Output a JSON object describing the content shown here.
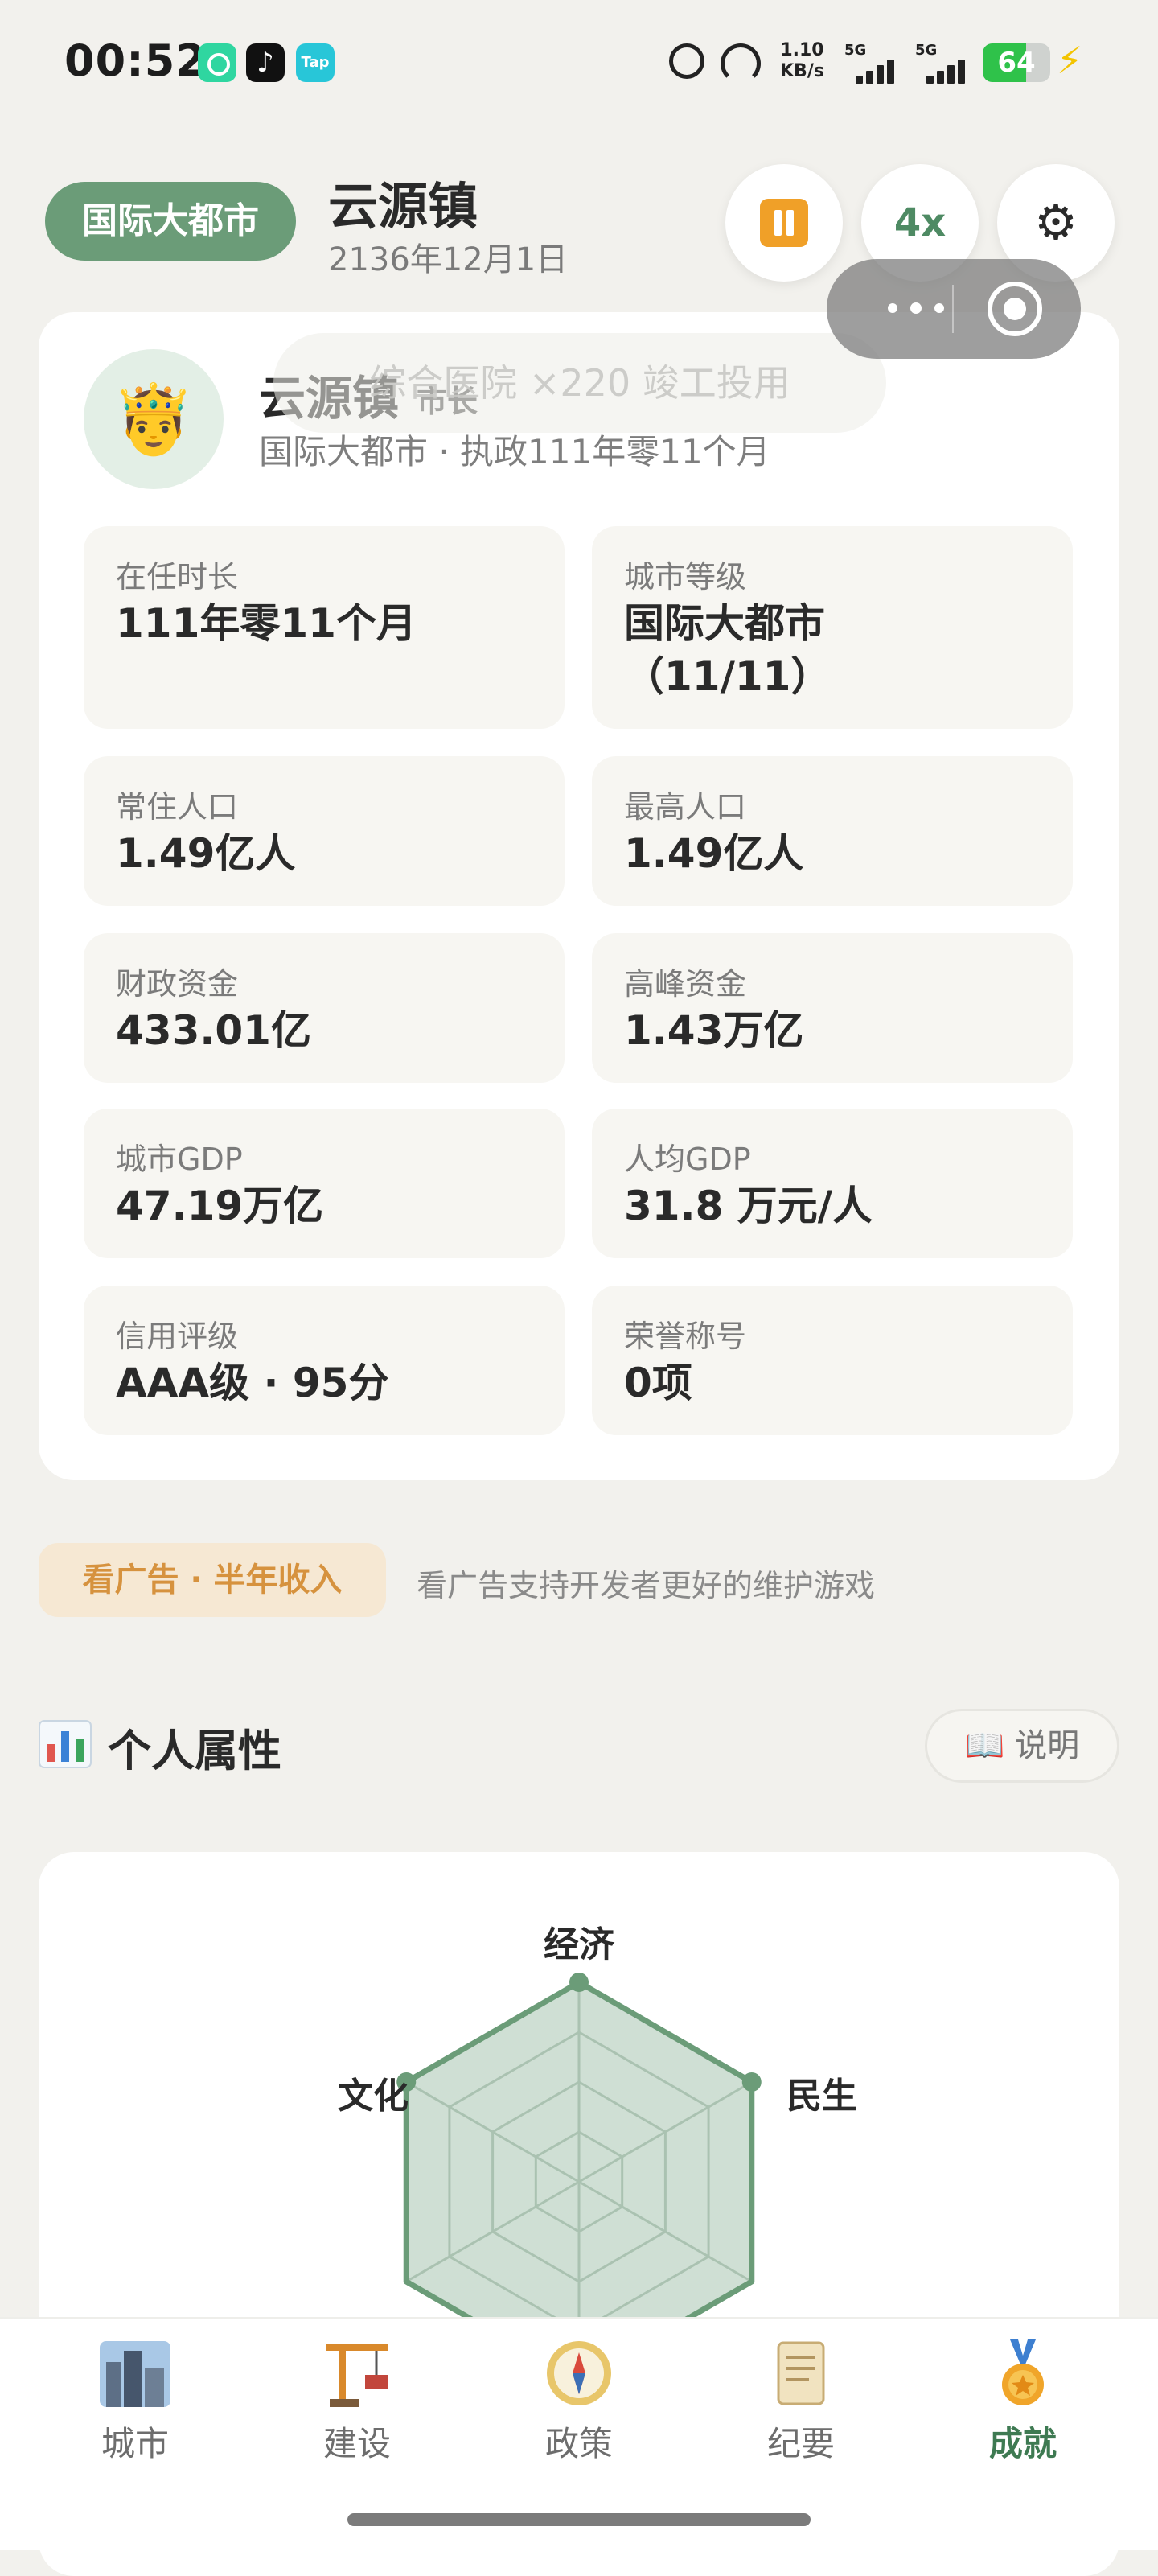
{
  "status_bar": {
    "time": "00:52",
    "tiktok_glyph": "♪",
    "tap_label": "Tap",
    "net_speed_value": "1.10",
    "net_speed_unit": "KB/s",
    "sim1_label": "5G",
    "sim2_label": "5G",
    "battery_percent": "64",
    "battery_level": 0.64,
    "bolt_glyph": "⚡",
    "icons": [
      "app-green-icon",
      "tiktok-icon",
      "taptap-icon",
      "alarm-icon",
      "speedometer-icon",
      "signal-icon",
      "battery-icon",
      "charging-icon"
    ]
  },
  "header": {
    "city_level_badge": "国际大都市",
    "city_name": "云源镇",
    "date": "2136年12月1日",
    "speed_label": "4x",
    "settings_glyph": "⚙",
    "accent_color": "#6b9c78"
  },
  "toast": {
    "text": "综合医院 ×220 竣工投用"
  },
  "profile": {
    "avatar_emoji": "🤴",
    "name": "云源镇",
    "title": "市长",
    "subtitle": "国际大都市 · 执政111年零11个月"
  },
  "stats": [
    {
      "label": "在任时长",
      "value": "111年零11个月"
    },
    {
      "label": "城市等级",
      "value": "国际大都市（11/11）"
    },
    {
      "label": "常住人口",
      "value": "1.49亿人"
    },
    {
      "label": "最高人口",
      "value": "1.49亿人"
    },
    {
      "label": "财政资金",
      "value": "433.01亿"
    },
    {
      "label": "高峰资金",
      "value": "1.43万亿"
    },
    {
      "label": "城市GDP",
      "value": "47.19万亿"
    },
    {
      "label": "人均GDP",
      "value": "31.8 万元/人"
    },
    {
      "label": "信用评级",
      "value": "AAA级 · 95分"
    },
    {
      "label": "荣誉称号",
      "value": "0项"
    }
  ],
  "ad": {
    "button_label": "看广告 · 半年收入",
    "note": "看广告支持开发者更好的维护游戏"
  },
  "attributes": {
    "section_icon": "📊",
    "section_title": "个人属性",
    "help_icon": "📖",
    "help_label": "说明",
    "radar_axes": [
      "经济",
      "民生",
      "文化"
    ],
    "radar_color": "#6b9c78"
  },
  "bottom_nav": [
    {
      "label": "城市",
      "icon": "city-icon",
      "glyph": "🏙",
      "active": false
    },
    {
      "label": "建设",
      "icon": "crane-icon",
      "glyph": "🏗",
      "active": false
    },
    {
      "label": "政策",
      "icon": "compass-icon",
      "glyph": "🧭",
      "active": false
    },
    {
      "label": "纪要",
      "icon": "scroll-icon",
      "glyph": "📜",
      "active": false
    },
    {
      "label": "成就",
      "icon": "medal-icon",
      "glyph": "🏅",
      "active": true
    }
  ]
}
